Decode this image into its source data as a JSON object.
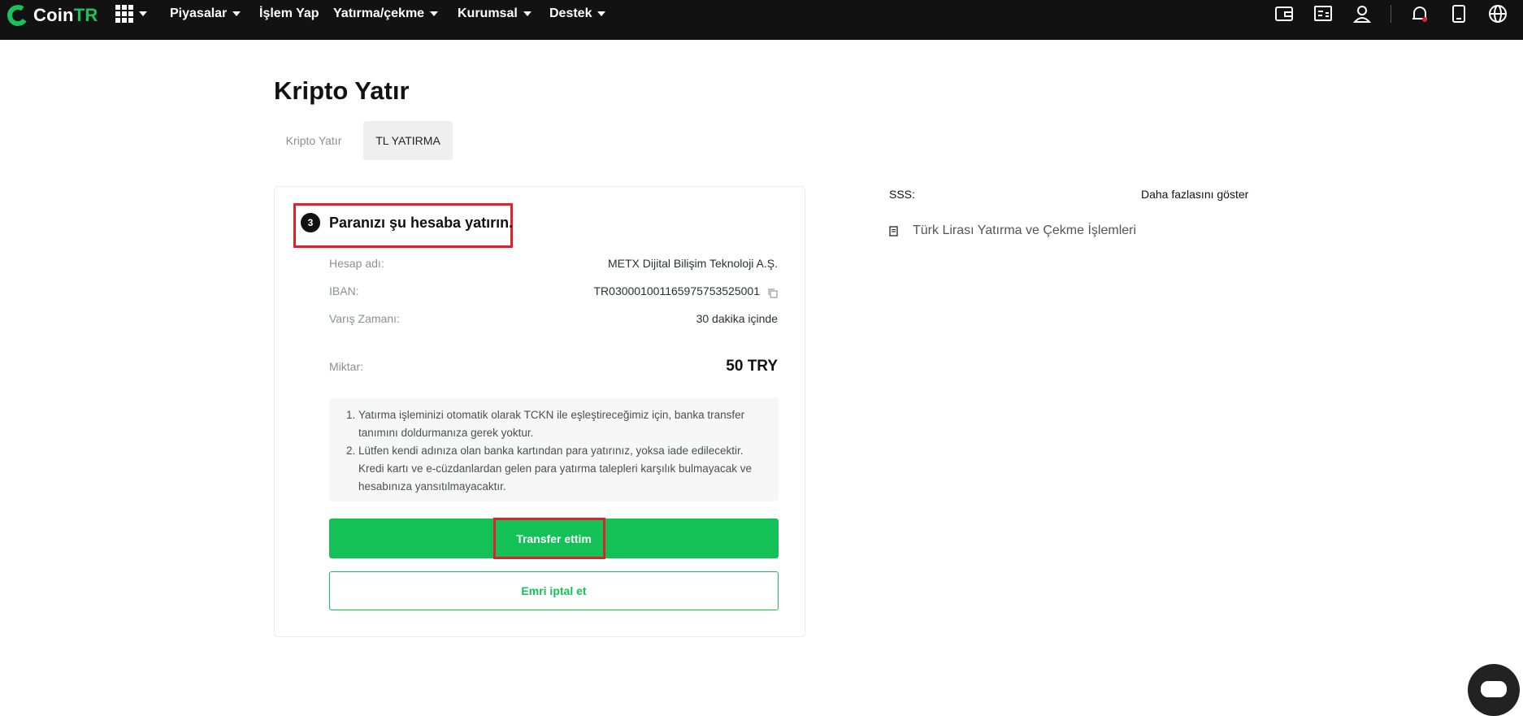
{
  "nav": {
    "brand_prefix": "Coin",
    "brand_suffix": "TR",
    "items": [
      {
        "label": "Piyasalar",
        "dropdown": true
      },
      {
        "label": "İşlem Yap",
        "dropdown": false
      },
      {
        "label": "Yatırma/çekme",
        "dropdown": true
      },
      {
        "label": "Kurumsal",
        "dropdown": true
      },
      {
        "label": "Destek",
        "dropdown": true
      }
    ],
    "icons": [
      "wallet-icon",
      "orders-icon",
      "user-icon",
      "bell-icon",
      "tablet-icon",
      "globe-icon"
    ]
  },
  "page": {
    "title": "Kripto Yatır",
    "tabs": [
      {
        "label": "Kripto Yatır",
        "active": false
      },
      {
        "label": "TL YATIRMA",
        "active": true
      }
    ]
  },
  "deposit": {
    "step_number": "3",
    "step_title": "Paranızı şu hesaba yatırın.",
    "rows": [
      {
        "label": "Hesap adı:",
        "value": "METX Dijital Bilişim Teknoloji A.Ş."
      },
      {
        "label": "IBAN:",
        "value": "TR030001001165975753525001"
      },
      {
        "label": "Varış Zamanı:",
        "value": "30 dakika içinde"
      }
    ],
    "amount_label": "Miktar:",
    "amount_value": "50 TRY",
    "notes": [
      "Yatırma işleminizi otomatik olarak TCKN ile eşleştireceğimiz için, banka transfer tanımını doldurmanıza gerek yoktur.",
      "Lütfen kendi adınıza olan banka kartından para yatırınız, yoksa iade edilecektir. Kredi kartı ve e-cüzdanlardan gelen para yatırma talepleri karşılık bulmayacak ve hesabınıza yansıtılmayacaktır."
    ],
    "confirm_button": "Transfer ettim",
    "cancel_button": "Emri iptal et"
  },
  "faq": {
    "title": "SSS:",
    "more_link": "Daha fazlasını göster",
    "items": [
      "Türk Lirası Yatırma ve Çekme İşlemleri"
    ]
  },
  "colors": {
    "brand_green": "#13c157",
    "nav_bg": "#121212",
    "highlight_red": "#e0212d"
  }
}
